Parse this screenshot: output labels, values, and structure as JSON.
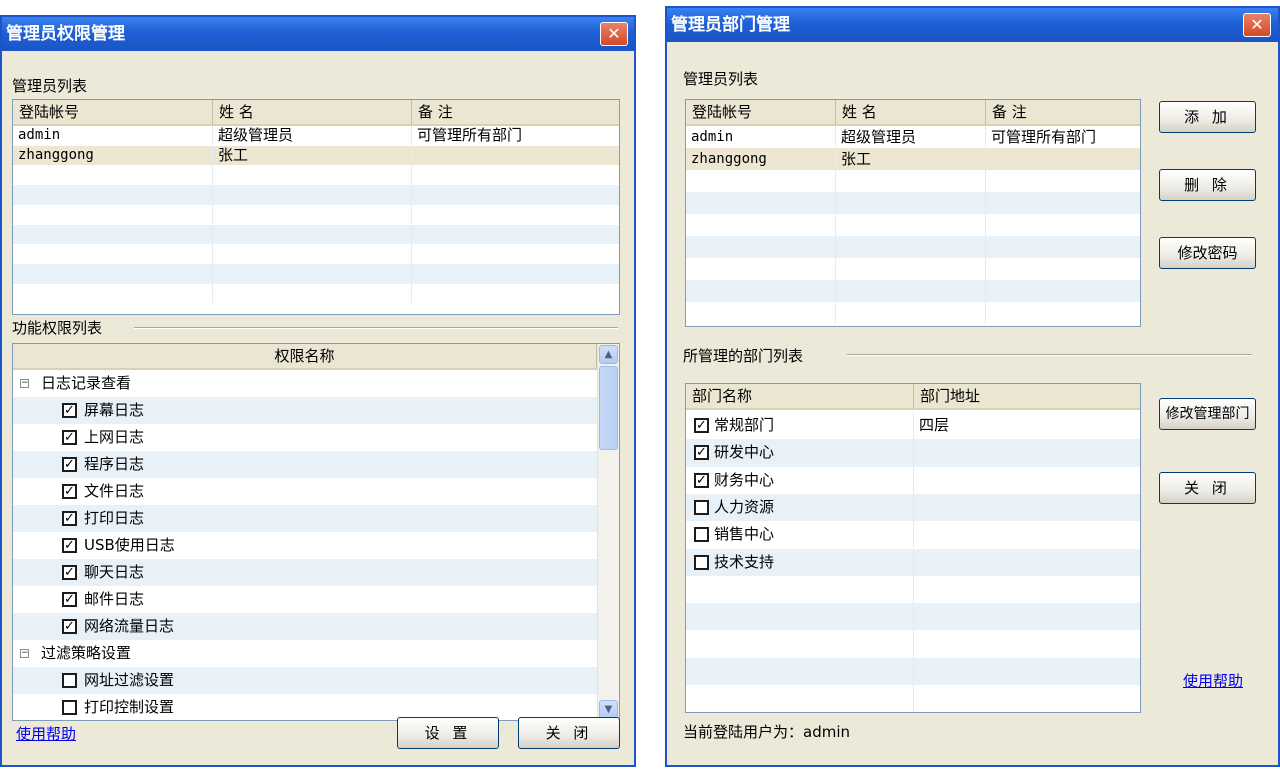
{
  "left_window": {
    "title": "管理员权限管理",
    "close_glyph": "✕",
    "admin_list_label": "管理员列表",
    "admin_table": {
      "columns": [
        "登陆帐号",
        "姓 名",
        "备 注"
      ],
      "rows": [
        {
          "account": "admin",
          "name": "超级管理员",
          "note": "可管理所有部门"
        },
        {
          "account": "zhanggong",
          "name": "张工",
          "note": ""
        }
      ]
    },
    "perm_list_label": "功能权限列表",
    "perm_tree": {
      "header": "权限名称",
      "groups": [
        {
          "label": "日志记录查看",
          "expander": "−",
          "items": [
            {
              "label": "屏幕日志",
              "checked": true
            },
            {
              "label": "上网日志",
              "checked": true
            },
            {
              "label": "程序日志",
              "checked": true
            },
            {
              "label": "文件日志",
              "checked": true
            },
            {
              "label": "打印日志",
              "checked": true
            },
            {
              "label": "USB使用日志",
              "checked": true
            },
            {
              "label": "聊天日志",
              "checked": true
            },
            {
              "label": "邮件日志",
              "checked": true
            },
            {
              "label": "网络流量日志",
              "checked": true
            }
          ]
        },
        {
          "label": "过滤策略设置",
          "expander": "−",
          "items": [
            {
              "label": "网址过滤设置",
              "checked": false
            },
            {
              "label": "打印控制设置",
              "checked": false
            }
          ]
        }
      ]
    },
    "help_link": "使用帮助",
    "settings_button": "设 置",
    "close_button": "关 闭"
  },
  "right_window": {
    "title": "管理员部门管理",
    "close_glyph": "✕",
    "admin_list_label": "管理员列表",
    "admin_table": {
      "columns": [
        "登陆帐号",
        "姓 名",
        "备 注"
      ],
      "rows": [
        {
          "account": "admin",
          "name": "超级管理员",
          "note": "可管理所有部门"
        },
        {
          "account": "zhanggong",
          "name": "张工",
          "note": ""
        }
      ]
    },
    "add_button": "添 加",
    "delete_button": "删 除",
    "change_password_button": "修改密码",
    "dept_list_label": "所管理的部门列表",
    "dept_table": {
      "columns": [
        "部门名称",
        "部门地址"
      ],
      "rows": [
        {
          "name": "常规部门",
          "address": "四层",
          "checked": true
        },
        {
          "name": "研发中心",
          "address": "",
          "checked": true
        },
        {
          "name": "财务中心",
          "address": "",
          "checked": true
        },
        {
          "name": "人力资源",
          "address": "",
          "checked": false
        },
        {
          "name": "销售中心",
          "address": "",
          "checked": false
        },
        {
          "name": "技术支持",
          "address": "",
          "checked": false
        }
      ]
    },
    "modify_dept_button": "修改管理部门",
    "close_button": "关 闭",
    "help_link": "使用帮助",
    "status_text": "当前登陆用户为：admin"
  },
  "colors": {
    "title_bar": "#1f5fd6",
    "window_face": "#ece9d8",
    "row_alt": "#e8f1f8",
    "row_selected": "#ede6d3",
    "link": "#0000ee"
  },
  "scrollbar": {
    "up_glyph": "▲",
    "down_glyph": "▼"
  }
}
